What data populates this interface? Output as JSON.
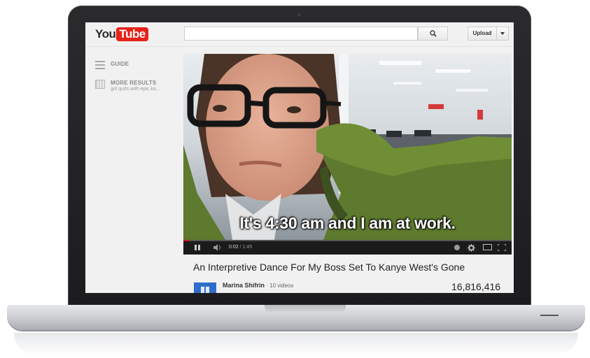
{
  "header": {
    "logo_you": "You",
    "logo_tube": "Tube",
    "search_placeholder": "",
    "upload_label": "Upload"
  },
  "guide": {
    "guide_label": "GUIDE",
    "more_results_label": "MORE RESULTS",
    "more_results_sub": "girl quits with epic ka..."
  },
  "player": {
    "subtitle": "It's 4:30 am and I am at work.",
    "current_time": "0:02",
    "separator": " / ",
    "duration": "1:45",
    "progress_fraction": 0.02
  },
  "video": {
    "title": "An Interpretive Dance For My Boss Set To Kanye West's Gone",
    "channel_name": "Marina Shifrin",
    "channel_separator": " · ",
    "channel_videos": "10 videos",
    "views": "16,816,416"
  },
  "colors": {
    "brand_red": "#e62117",
    "progress_red": "#cc181e",
    "channel_avatar": "#2f6ec9"
  }
}
